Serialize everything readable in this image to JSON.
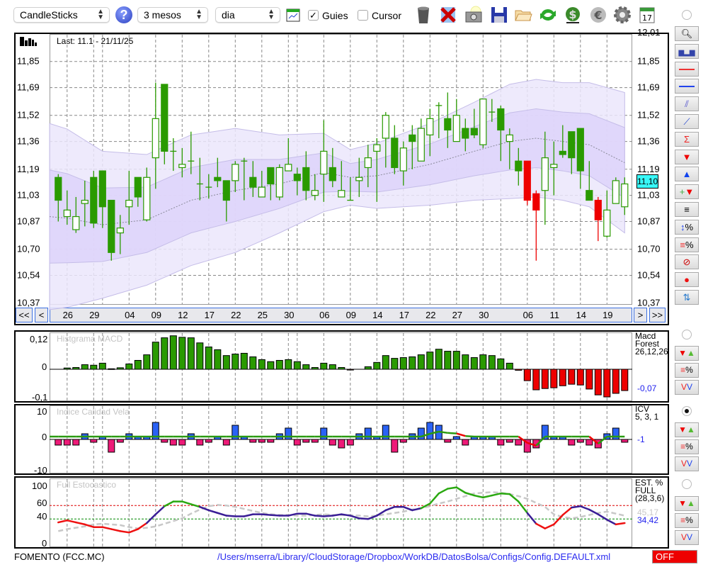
{
  "toolbar": {
    "chart_type": "CandleSticks",
    "period": "3 mesos",
    "interval": "dia",
    "guides_label": "Guies",
    "guides_checked": true,
    "cursor_label": "Cursor",
    "cursor_checked": false
  },
  "main": {
    "last_label": "Last: 11.1 - 21/11/25",
    "current_price": "11,10",
    "y_ticks": [
      "12,01",
      "11,85",
      "11,69",
      "11,52",
      "11,36",
      "11,19",
      "11,03",
      "10,87",
      "10,70",
      "10,54",
      "10,37"
    ],
    "y_values": [
      12.01,
      11.85,
      11.69,
      11.52,
      11.36,
      11.19,
      11.03,
      10.87,
      10.7,
      10.54,
      10.37
    ],
    "nav": {
      "first": "<<",
      "prev": "<",
      "next": ">",
      "last": ">>"
    },
    "x_labels": [
      {
        "i": 1,
        "t": "26"
      },
      {
        "i": 4,
        "t": "29"
      },
      {
        "i": 8,
        "t": "04"
      },
      {
        "i": 11,
        "t": "09"
      },
      {
        "i": 14,
        "t": "12"
      },
      {
        "i": 17,
        "t": "17"
      },
      {
        "i": 20,
        "t": "22"
      },
      {
        "i": 23,
        "t": "25"
      },
      {
        "i": 26,
        "t": "30"
      },
      {
        "i": 30,
        "t": "06"
      },
      {
        "i": 33,
        "t": "09"
      },
      {
        "i": 36,
        "t": "14"
      },
      {
        "i": 39,
        "t": "17"
      },
      {
        "i": 42,
        "t": "22"
      },
      {
        "i": 45,
        "t": "27"
      },
      {
        "i": 48,
        "t": "30"
      },
      {
        "i": 53,
        "t": "06"
      },
      {
        "i": 56,
        "t": "11"
      },
      {
        "i": 59,
        "t": "14"
      },
      {
        "i": 62,
        "t": "19"
      }
    ],
    "extra_grid": [
      5,
      27,
      50
    ],
    "colors": {
      "up": "#2a9a00",
      "red": "#ee0000",
      "band_outer": "#ebe6fc",
      "band_inner": "#ddd4fa",
      "band_stroke": "#c5bde8"
    }
  },
  "chart_data": [
    {
      "type": "candlestick",
      "title": "Last: 11.1 - 21/11/25",
      "ylim": [
        10.37,
        12.01
      ],
      "ohlc": [
        [
          11.14,
          11.16,
          10.87,
          11.0
        ],
        [
          10.9,
          11.06,
          10.85,
          10.94
        ],
        [
          10.82,
          11.02,
          10.8,
          10.9
        ],
        [
          10.98,
          11.12,
          10.84,
          11.0
        ],
        [
          11.14,
          11.18,
          10.83,
          10.86
        ],
        [
          11.18,
          11.18,
          10.83,
          10.96
        ],
        [
          11.0,
          11.0,
          10.63,
          10.68
        ],
        [
          10.8,
          10.91,
          10.67,
          10.83
        ],
        [
          10.96,
          11.18,
          10.85,
          11.0
        ],
        [
          11.14,
          11.14,
          10.96,
          11.02
        ],
        [
          10.88,
          11.2,
          10.87,
          11.14
        ],
        [
          11.26,
          11.72,
          11.07,
          11.5
        ],
        [
          11.71,
          11.71,
          11.22,
          11.3
        ],
        [
          11.3,
          11.38,
          11.18,
          11.3
        ],
        [
          11.2,
          11.32,
          11.14,
          11.22
        ],
        [
          11.24,
          11.42,
          11.16,
          11.24
        ],
        [
          11.1,
          11.26,
          11.0,
          11.1
        ],
        [
          11.08,
          11.16,
          11.01,
          11.08
        ],
        [
          11.14,
          11.26,
          11.08,
          11.12
        ],
        [
          11.12,
          11.12,
          10.87,
          11.0
        ],
        [
          11.12,
          11.24,
          11.05,
          11.22
        ],
        [
          11.24,
          11.26,
          11.0,
          11.24
        ],
        [
          11.14,
          11.24,
          11.02,
          11.08
        ],
        [
          11.02,
          11.18,
          11.02,
          11.08
        ],
        [
          11.2,
          11.2,
          11.0,
          11.1
        ],
        [
          11.02,
          11.22,
          11.0,
          11.2
        ],
        [
          11.18,
          11.38,
          11.18,
          11.22
        ],
        [
          11.16,
          11.2,
          11.03,
          11.12
        ],
        [
          11.2,
          11.3,
          11.0,
          11.06
        ],
        [
          11.03,
          11.16,
          11.0,
          11.06
        ],
        [
          11.16,
          11.49,
          10.99,
          11.3
        ],
        [
          11.2,
          11.32,
          11.08,
          11.12
        ],
        [
          11.02,
          11.24,
          11.02,
          11.06
        ],
        [
          11.0,
          11.14,
          11.0,
          11.0
        ],
        [
          11.12,
          11.26,
          11.02,
          11.14
        ],
        [
          11.2,
          11.34,
          11.08,
          11.26
        ],
        [
          11.3,
          11.38,
          10.99,
          11.34
        ],
        [
          11.38,
          11.54,
          11.2,
          11.52
        ],
        [
          11.38,
          11.46,
          11.16,
          11.2
        ],
        [
          11.18,
          11.36,
          11.09,
          11.32
        ],
        [
          11.4,
          11.46,
          11.19,
          11.36
        ],
        [
          11.24,
          11.5,
          11.24,
          11.44
        ],
        [
          11.4,
          11.56,
          11.27,
          11.5
        ],
        [
          11.58,
          11.6,
          11.38,
          11.58
        ],
        [
          11.5,
          11.66,
          11.32,
          11.43
        ],
        [
          11.36,
          11.62,
          11.36,
          11.52
        ],
        [
          11.44,
          11.5,
          11.3,
          11.38
        ],
        [
          11.44,
          11.56,
          11.38,
          11.4
        ],
        [
          11.34,
          11.62,
          11.32,
          11.62
        ],
        [
          11.54,
          11.62,
          11.48,
          11.54
        ],
        [
          11.56,
          11.58,
          11.24,
          11.43
        ],
        [
          11.36,
          11.44,
          11.19,
          11.4
        ],
        [
          11.24,
          11.32,
          11.09,
          11.18
        ],
        [
          11.24,
          11.24,
          10.97,
          11.0
        ],
        [
          11.04,
          11.06,
          10.63,
          10.94
        ],
        [
          11.06,
          11.42,
          10.85,
          11.26
        ],
        [
          11.2,
          11.36,
          11.03,
          11.22
        ],
        [
          11.3,
          11.46,
          11.26,
          11.28
        ],
        [
          11.42,
          11.42,
          11.16,
          11.26
        ],
        [
          11.44,
          11.44,
          11.07,
          11.18
        ],
        [
          11.06,
          11.24,
          11.0,
          11.0
        ],
        [
          11.0,
          11.02,
          10.75,
          10.88
        ],
        [
          10.78,
          11.06,
          10.77,
          10.94
        ],
        [
          10.98,
          11.14,
          10.98,
          11.12
        ],
        [
          10.96,
          11.14,
          10.91,
          11.1
        ]
      ],
      "red_candles": [
        53,
        54,
        61
      ],
      "bands_keypoints": [
        [
          0,
          10.9,
          0.57
        ],
        [
          5,
          10.85,
          0.45
        ],
        [
          10,
          10.88,
          0.4
        ],
        [
          15,
          11.0,
          0.4
        ],
        [
          20,
          11.06,
          0.38
        ],
        [
          25,
          11.1,
          0.3
        ],
        [
          30,
          11.17,
          0.24
        ],
        [
          33,
          11.14,
          0.17
        ],
        [
          36,
          11.15,
          0.2
        ],
        [
          42,
          11.22,
          0.25
        ],
        [
          47,
          11.3,
          0.3
        ],
        [
          51,
          11.36,
          0.35
        ],
        [
          54,
          11.38,
          0.36
        ],
        [
          57,
          11.36,
          0.36
        ],
        [
          60,
          11.34,
          0.38
        ],
        [
          64,
          11.23,
          0.43
        ]
      ]
    },
    {
      "type": "bar",
      "title": "Histgrama MACD",
      "y_ticks": [
        "0,12",
        "0",
        "-0,1"
      ],
      "legend": [
        "Macd",
        "Forest",
        "26,12,26"
      ],
      "last_value": "-0,07",
      "values": [
        0,
        0.005,
        0.007,
        0.018,
        0.016,
        0.024,
        0.002,
        0.006,
        0.021,
        0.035,
        0.057,
        0.107,
        0.124,
        0.132,
        0.126,
        0.124,
        0.104,
        0.088,
        0.077,
        0.054,
        0.06,
        0.063,
        0.049,
        0.038,
        0.03,
        0.035,
        0.038,
        0.03,
        0.018,
        0.007,
        0.024,
        0.018,
        0.007,
        -0.003,
        0,
        0.01,
        0.027,
        0.054,
        0.043,
        0.046,
        0.049,
        0.057,
        0.068,
        0.079,
        0.071,
        0.071,
        0.057,
        0.046,
        0.057,
        0.054,
        0.041,
        0.024,
        -0.004,
        -0.045,
        -0.081,
        -0.076,
        -0.073,
        -0.065,
        -0.059,
        -0.062,
        -0.078,
        -0.101,
        -0.109,
        -0.095,
        -0.084
      ]
    },
    {
      "type": "bar",
      "title": "Indice Calidad Vela",
      "y_ticks": [
        "10",
        "0",
        "-10"
      ],
      "legend": [
        "ICV",
        "5, 3, 1"
      ],
      "last_value": "-1",
      "values": [
        -2,
        -2,
        -2,
        2,
        -1,
        1,
        -4.5,
        -1,
        2,
        1,
        1,
        6,
        -1,
        -2,
        -2,
        2,
        -2,
        -1,
        1,
        -2,
        5,
        1,
        -1,
        -1,
        -1,
        2,
        4,
        -2,
        -1,
        -1,
        4,
        -2,
        -3,
        -2,
        2,
        4,
        1,
        5,
        -4.5,
        -1,
        2,
        4,
        6,
        5,
        -1,
        1,
        -2,
        1,
        1,
        1,
        -2,
        -1,
        -2,
        -4.5,
        -3,
        5,
        1,
        1,
        -2,
        -1,
        -2,
        -3,
        2,
        4,
        -1
      ],
      "signal": [
        1,
        1,
        1,
        1,
        1,
        1,
        1,
        1,
        1,
        1,
        1,
        1,
        1,
        1,
        1,
        1,
        1,
        1,
        1,
        1,
        1,
        1,
        1,
        1,
        1,
        1,
        1,
        1,
        1,
        1,
        1,
        1,
        1,
        1,
        1,
        1,
        1,
        1,
        1,
        1,
        1,
        1,
        2,
        2.75,
        2.3,
        2.1,
        1.2,
        1,
        1,
        1,
        1,
        1,
        1,
        -1.2,
        -2.2,
        1,
        1,
        1,
        1,
        1,
        1,
        -1.5,
        1,
        1,
        1
      ]
    },
    {
      "type": "line",
      "title": "Full Estocastico",
      "y_ticks": [
        "100",
        "60",
        "40",
        "0"
      ],
      "levels": [
        60,
        40
      ],
      "legend": [
        "EST. %",
        "FULL",
        "(28,3,6)"
      ],
      "last_d": "45,17",
      "last_k": "34,42",
      "k": [
        35,
        38,
        35,
        32,
        28,
        28,
        25,
        22,
        20,
        25,
        34,
        47,
        59,
        66,
        66,
        62,
        58,
        53,
        49,
        45,
        44,
        44,
        47,
        47,
        46,
        45,
        45,
        48,
        48,
        45,
        44,
        45,
        47,
        45,
        41,
        40,
        45,
        53,
        58,
        58,
        53,
        56,
        63,
        78,
        85,
        87,
        79,
        75,
        72,
        75,
        78,
        77,
        66,
        49,
        33,
        26,
        32,
        46,
        57,
        59,
        54,
        47,
        39,
        32,
        34
      ],
      "k_colors": "rrrrrrrrrrrppggggpppppppppppppppppppppppppggggggggggggprrrrppppprrrr",
      "d": [
        22,
        25,
        27,
        29,
        32,
        33,
        32,
        31,
        28,
        26,
        27,
        29,
        33,
        37,
        41,
        48,
        54,
        59,
        61,
        60,
        58,
        55,
        52,
        49,
        47,
        46,
        46,
        45,
        45,
        46,
        47,
        46,
        46,
        46,
        45,
        44,
        45,
        47,
        49,
        51,
        54,
        56,
        59,
        63,
        66,
        70,
        74,
        78,
        79,
        80,
        79,
        77,
        74,
        70,
        64,
        58,
        47,
        43,
        41,
        43,
        46,
        49,
        51,
        48,
        45
      ]
    }
  ],
  "footer": {
    "symbol": "FOMENTO (FCC.MC)",
    "config_path": "/Users/mserra/Library/CloudStorage/Dropbox/WorkDB/DatosBolsa/Configs/Config.DEFAULT.xml",
    "status": "OFF"
  }
}
